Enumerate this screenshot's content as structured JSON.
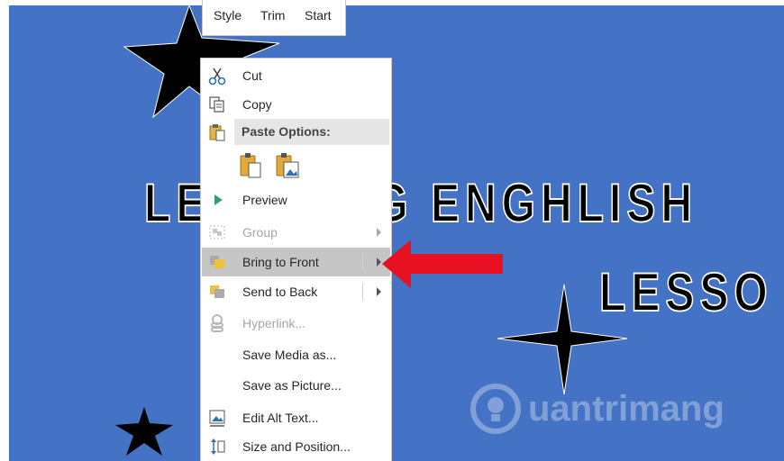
{
  "mini_toolbar": {
    "style": "Style",
    "trim": "Trim",
    "start": "Start"
  },
  "slide": {
    "title_line1": "LEARNING ENGHLISH",
    "title_line2": "LESSO",
    "watermark": "uantrimang"
  },
  "context_menu": {
    "cut": {
      "label": "Cut",
      "icon": "scissors-icon"
    },
    "copy": {
      "label": "Copy",
      "icon": "copy-icon"
    },
    "paste_options": {
      "label": "Paste Options:",
      "icon": "paste-icon"
    },
    "preview": {
      "label": "Preview",
      "icon": "play-icon"
    },
    "group": {
      "label": "Group",
      "icon": "group-icon",
      "disabled": true
    },
    "bring_to_front": {
      "label": "Bring to Front",
      "icon": "bring-to-front-icon",
      "highlighted": true
    },
    "send_to_back": {
      "label": "Send to Back",
      "icon": "send-to-back-icon"
    },
    "hyperlink": {
      "label": "Hyperlink...",
      "icon": "link-icon",
      "disabled": true
    },
    "save_media": {
      "label": "Save Media as..."
    },
    "save_picture": {
      "label": "Save as Picture..."
    },
    "edit_alt_text": {
      "label": "Edit Alt Text...",
      "icon": "alt-text-icon"
    },
    "size_position": {
      "label": "Size and Position...",
      "icon": "size-position-icon"
    }
  },
  "colors": {
    "slide_bg": "#4472c4",
    "highlight": "#c6c6c6",
    "arrow": "#e81123"
  }
}
